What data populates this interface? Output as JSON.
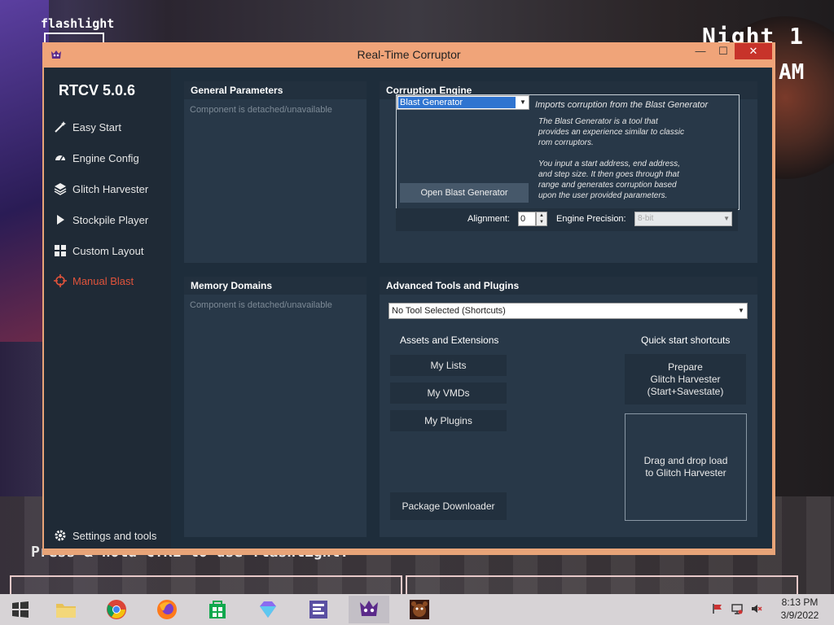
{
  "game": {
    "flashlight_label": "flashlight",
    "night_label": "Night 1",
    "time_label": "AM",
    "hint": "Press & hold CTRL to use flashlight."
  },
  "window": {
    "title": "Real-Time Corruptor",
    "minimize": "—",
    "maximize": "☐",
    "close": "✕"
  },
  "sidebar": {
    "version": "RTCV 5.0.6",
    "items": [
      {
        "label": "Easy Start",
        "icon": "magic-wand-icon"
      },
      {
        "label": "Engine Config",
        "icon": "gauge-icon"
      },
      {
        "label": "Glitch Harvester",
        "icon": "layers-icon"
      },
      {
        "label": "Stockpile Player",
        "icon": "play-icon"
      },
      {
        "label": "Custom Layout",
        "icon": "grid-icon"
      },
      {
        "label": "Manual Blast",
        "icon": "crosshair-icon",
        "active": true
      }
    ],
    "settings": "Settings and tools"
  },
  "general_params": {
    "title": "General Parameters",
    "status": "Component is detached/unavailable"
  },
  "memory_domains": {
    "title": "Memory Domains",
    "status": "Component is detached/unavailable"
  },
  "engine": {
    "title": "Corruption Engine",
    "selected": "Blast Generator",
    "desc_title": "Imports corruption from the Blast Generator",
    "desc_1": "The Blast Generator is a tool that\nprovides an experience similar to classic\nrom corruptors.",
    "desc_2": "You input a start address, end address,\nand step size. It then goes through that\nrange and generates corruption based\nupon the user provided parameters.",
    "open_button": "Open Blast Generator",
    "alignment_label": "Alignment:",
    "alignment_value": "0",
    "precision_label": "Engine Precision:",
    "precision_value": "8-bit"
  },
  "advanced": {
    "title": "Advanced Tools and Plugins",
    "tool_select": "No Tool Selected (Shortcuts)",
    "assets_heading": "Assets and Extensions",
    "my_lists": "My Lists",
    "my_vmds": "My VMDs",
    "my_plugins": "My Plugins",
    "package_downloader": "Package Downloader",
    "quick_heading": "Quick start shortcuts",
    "prepare_1": "Prepare",
    "prepare_2": "Glitch Harvester",
    "prepare_3": "(Start+Savestate)",
    "drop_1": "Drag and drop load",
    "drop_2": "to Glitch Harvester"
  },
  "taskbar": {
    "time": "8:13 PM",
    "date": "3/9/2022"
  },
  "colors": {
    "accent": "#e0533b",
    "titlebar": "#f0a479",
    "panel": "#283848",
    "sidebar": "#1f2a36"
  }
}
